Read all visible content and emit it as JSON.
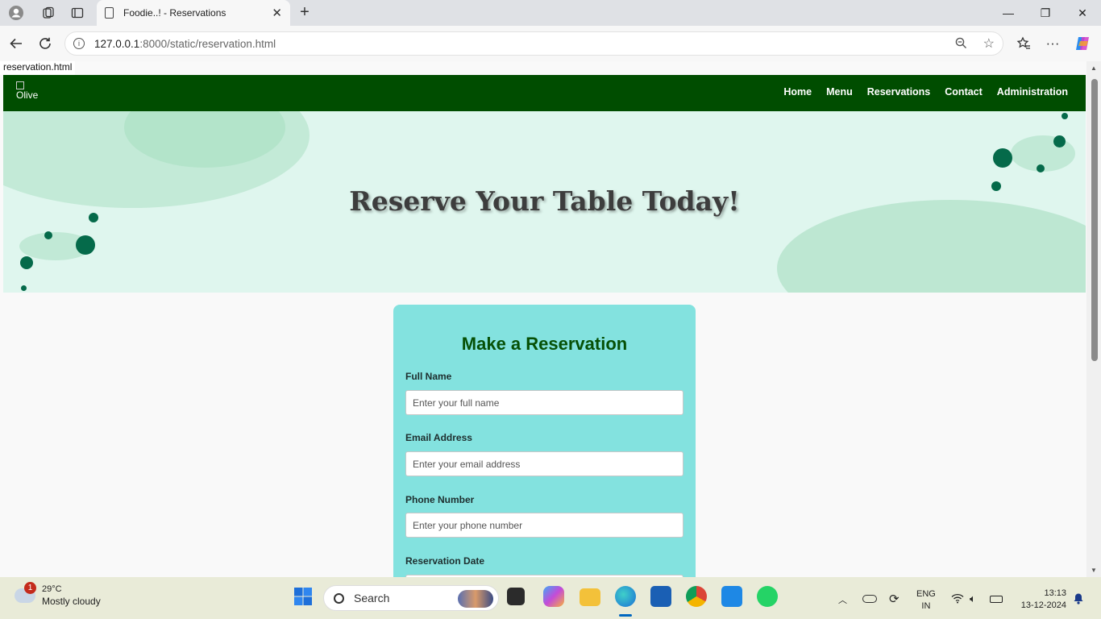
{
  "browser": {
    "tab_title": "Foodie..! - Reservations",
    "url_host": "127.0.0.1",
    "url_rest": ":8000/static/reservation.html"
  },
  "page": {
    "status_text": "reservation.html",
    "logo_alt": "Olive",
    "nav": [
      "Home",
      "Menu",
      "Reservations",
      "Contact",
      "Administration"
    ],
    "hero_title": "Reserve Your Table Today!",
    "form": {
      "title": "Make a Reservation",
      "fields": [
        {
          "label": "Full Name",
          "placeholder": "Enter your full name"
        },
        {
          "label": "Email Address",
          "placeholder": "Enter your email address"
        },
        {
          "label": "Phone Number",
          "placeholder": "Enter your phone number"
        },
        {
          "label": "Reservation Date",
          "placeholder": ""
        }
      ]
    }
  },
  "taskbar": {
    "weather_badge": "1",
    "temperature": "29°C",
    "condition": "Mostly cloudy",
    "search_label": "Search",
    "lang_line1": "ENG",
    "lang_line2": "IN",
    "time": "13:13",
    "date": "13-12-2024"
  },
  "colors": {
    "nav_bg": "#004d00",
    "card_bg": "#83e2df",
    "form_title": "#065006",
    "hero_bg": "#dff6ee"
  }
}
